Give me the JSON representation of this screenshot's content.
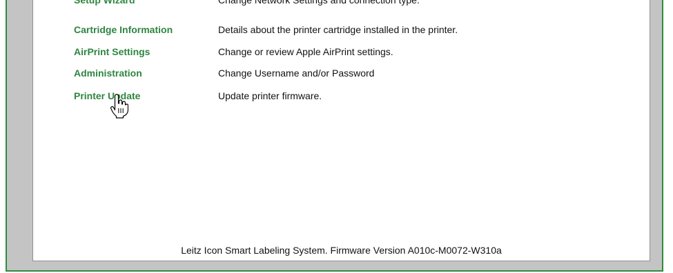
{
  "menu": {
    "items": [
      {
        "label": "Setup Wizard",
        "description": "Change Network Settings and connection type."
      },
      {
        "label": "Cartridge Information",
        "description": "Details about the printer cartridge installed in the printer."
      },
      {
        "label": "AirPrint Settings",
        "description": "Change or review Apple AirPrint settings."
      },
      {
        "label": "Administration",
        "description": "Change Username and/or Password"
      },
      {
        "label": "Printer Update",
        "description": "Update printer firmware."
      }
    ]
  },
  "footer": {
    "text": "Leitz Icon Smart Labeling System. Firmware Version A010c-M0072-W310a"
  },
  "colors": {
    "link": "#2e8540",
    "frame_border": "#2e8b3e",
    "gutter": "#c4c4c4"
  },
  "cursor": {
    "icon": "hand-pointer-icon"
  }
}
